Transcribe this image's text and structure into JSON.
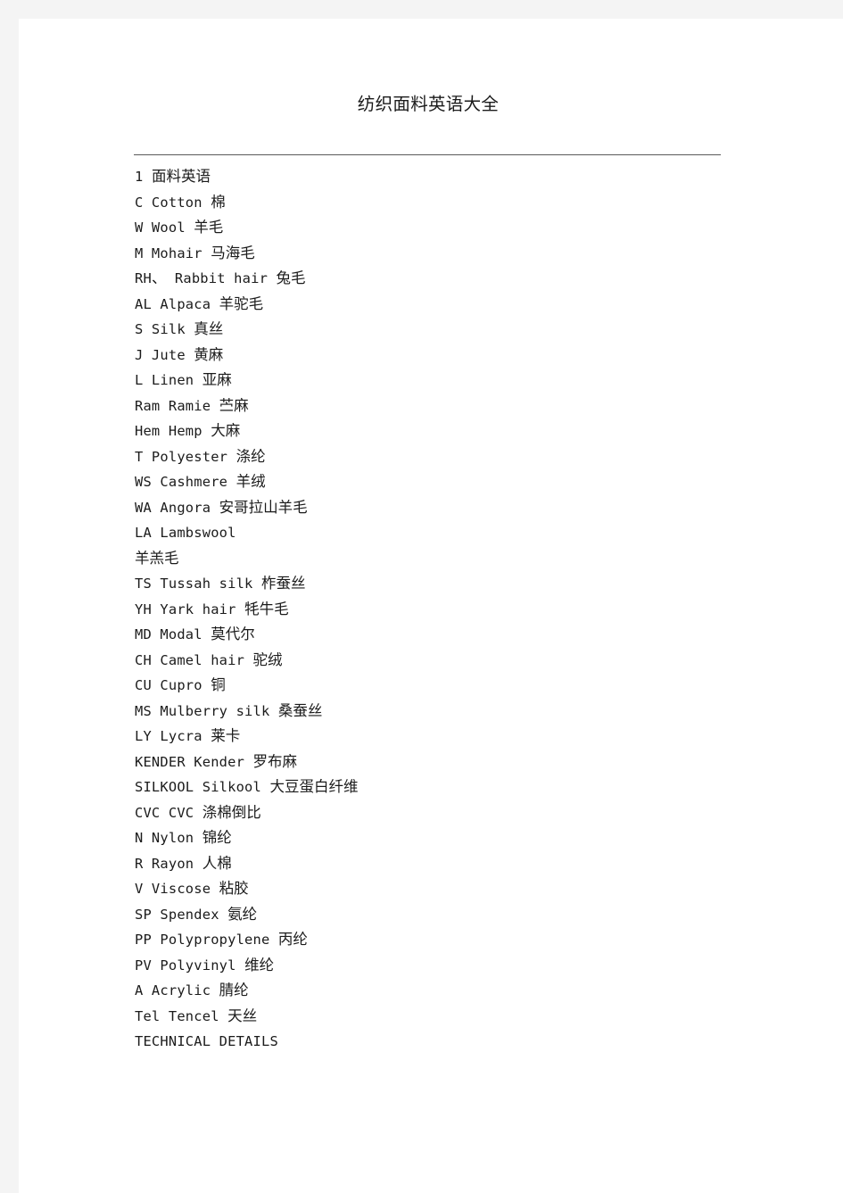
{
  "page": {
    "background_color": "#f4f4f4",
    "sheet_color": "#ffffff",
    "text_color": "#1b1b1b",
    "rule_color": "#5a5a5a"
  },
  "document": {
    "title": "纺织面料英语大全",
    "section_heading": "1 面料英语",
    "lines": [
      "1 面料英语",
      "C Cotton 棉",
      "W Wool 羊毛",
      "M Mohair 马海毛",
      "RH、 Rabbit hair 兔毛",
      "AL Alpaca 羊驼毛",
      "S Silk 真丝",
      "J Jute 黄麻",
      "L Linen 亚麻",
      "Ram Ramie 苎麻",
      "Hem Hemp 大麻",
      "T Polyester 涤纶",
      "WS Cashmere 羊绒",
      "WA Angora 安哥拉山羊毛",
      "LA Lambswool",
      "羊羔毛",
      "TS Tussah silk 柞蚕丝",
      "YH Yark hair 牦牛毛",
      "MD Modal 莫代尔",
      "CH Camel hair 驼绒",
      "CU Cupro 铜",
      "MS Mulberry silk 桑蚕丝",
      "LY Lycra 莱卡",
      "KENDER Kender 罗布麻",
      "SILKOOL Silkool 大豆蛋白纤维",
      "CVC CVC 涤棉倒比",
      "N Nylon 锦纶",
      "R Rayon 人棉",
      "V Viscose 粘胶",
      "SP Spendex 氨纶",
      "PP Polypropylene 丙纶",
      "PV Polyvinyl 维纶",
      "A Acrylic 腈纶",
      "Tel Tencel 天丝",
      "TECHNICAL DETAILS"
    ]
  }
}
